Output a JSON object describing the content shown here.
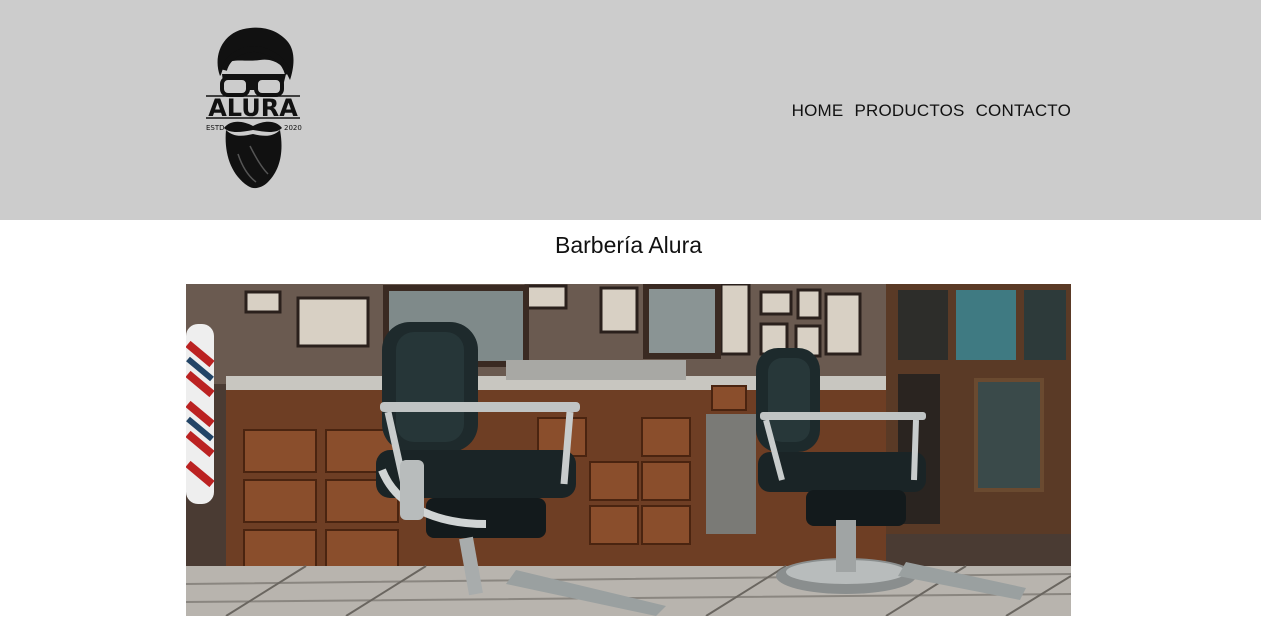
{
  "header": {
    "logo": {
      "icon": "bearded-man-glasses-logo",
      "brand_text": "ALURA",
      "estd_left": "ESTD",
      "estd_right": "2020"
    },
    "nav": [
      {
        "label": "HOME"
      },
      {
        "label": "PRODUCTOS"
      },
      {
        "label": "CONTACTO"
      }
    ]
  },
  "main": {
    "title": "Barbería Alura",
    "banner": {
      "icon": "barbershop-interior-photo"
    }
  },
  "colors": {
    "header_bg": "#cccccc",
    "page_bg": "#ffffff",
    "text": "#111111"
  }
}
